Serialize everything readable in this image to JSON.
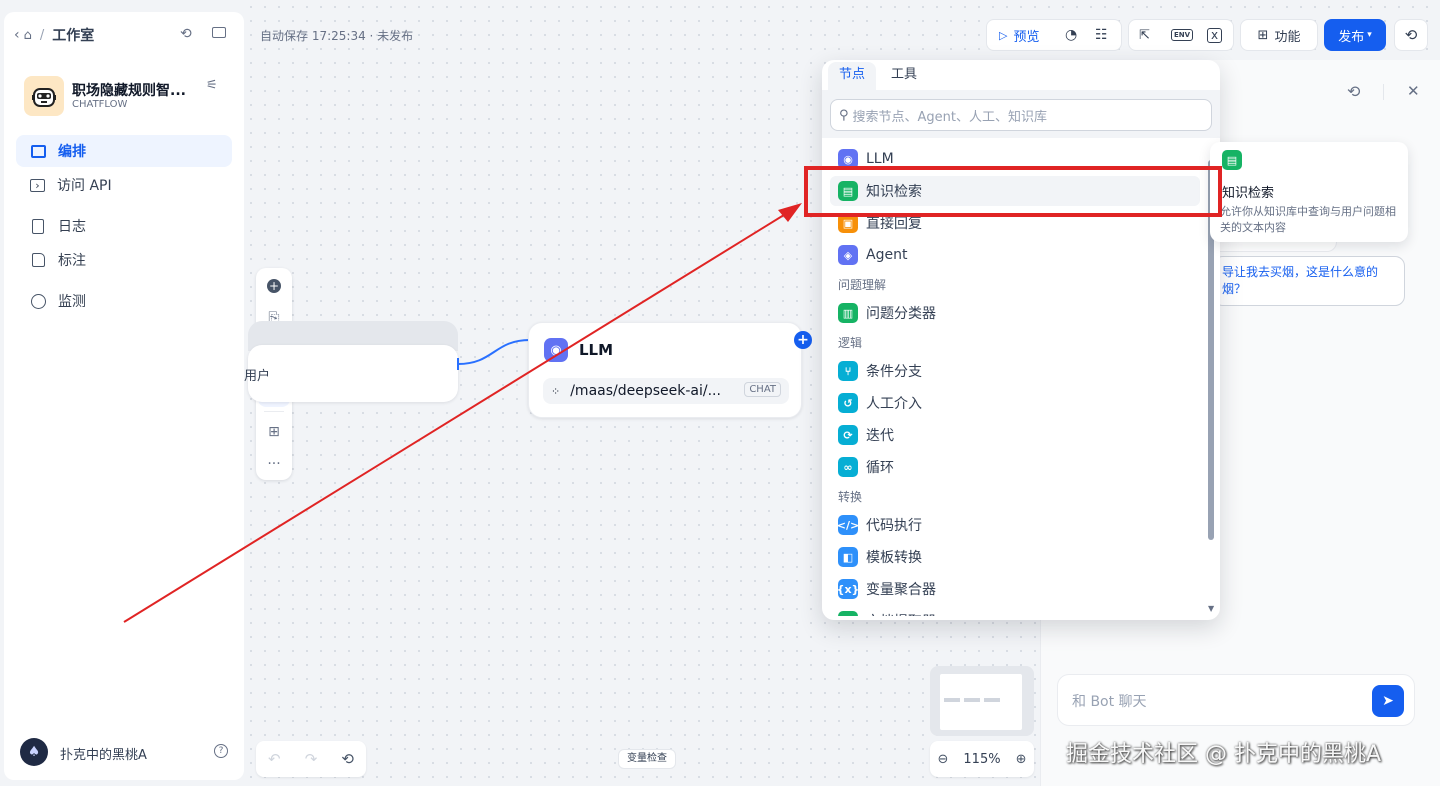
{
  "sidebar": {
    "workspace_label": "工作室",
    "app_name": "职场隐藏规则智...",
    "app_type": "CHATFLOW",
    "nav": [
      {
        "label": "编排",
        "icon": "layout-icon",
        "active": true
      },
      {
        "label": "访问 API",
        "icon": "terminal-icon",
        "active": false
      },
      {
        "label": "日志",
        "icon": "doc-icon",
        "active": false
      },
      {
        "label": "标注",
        "icon": "annotation-icon",
        "active": false
      },
      {
        "label": "监测",
        "icon": "gauge-icon",
        "active": false
      }
    ],
    "user_name": "扑克中的黑桃A"
  },
  "header": {
    "autosave": "自动保存 17:25:34 · 未发布",
    "preview_label": "预览",
    "env_label": "ENV",
    "features_label": "功能",
    "publish_label": "发布"
  },
  "canvas": {
    "start_node_text": "用户",
    "llm_node": {
      "title": "LLM",
      "model": "/maas/deepseek-ai/...",
      "badge": "CHAT"
    },
    "zoom": "115%",
    "var_inspect": "变量检查"
  },
  "picker": {
    "tabs": [
      "节点",
      "工具"
    ],
    "search_placeholder": "搜索节点、Agent、人工、知识库",
    "items_top": [
      {
        "label": "LLM",
        "color": "#6172f3",
        "glyph": "◉"
      },
      {
        "label": "知识检索",
        "color": "#16b364",
        "glyph": "▤"
      },
      {
        "label": "直接回复",
        "color": "#f79009",
        "glyph": "▣"
      },
      {
        "label": "Agent",
        "color": "#6172f3",
        "glyph": "◈"
      }
    ],
    "group1": "问题理解",
    "items_g1": [
      {
        "label": "问题分类器",
        "color": "#16b364",
        "glyph": "▥"
      }
    ],
    "group2": "逻辑",
    "items_g2": [
      {
        "label": "条件分支",
        "color": "#06aed4",
        "glyph": "⑂"
      },
      {
        "label": "人工介入",
        "color": "#06aed4",
        "glyph": "↺"
      },
      {
        "label": "迭代",
        "color": "#06aed4",
        "glyph": "⟳"
      },
      {
        "label": "循环",
        "color": "#06aed4",
        "glyph": "∞"
      }
    ],
    "group3": "转换",
    "items_g3": [
      {
        "label": "代码执行",
        "color": "#2e90fa",
        "glyph": "</>"
      },
      {
        "label": "模板转换",
        "color": "#2e90fa",
        "glyph": "◧"
      },
      {
        "label": "变量聚合器",
        "color": "#2e90fa",
        "glyph": "{x}"
      },
      {
        "label": "文档提取器",
        "color": "#16b364",
        "glyph": "▤"
      }
    ]
  },
  "tooltip": {
    "title": "知识检索",
    "desc": "允许你从知识库中查询与用户问题相关的文本内容"
  },
  "chat": {
    "suggestion": "导让我去买烟，这是什么意的烟？",
    "input_placeholder": "和 Bot 聊天"
  },
  "watermark": "掘金技术社区 @ 扑克中的黑桃A"
}
